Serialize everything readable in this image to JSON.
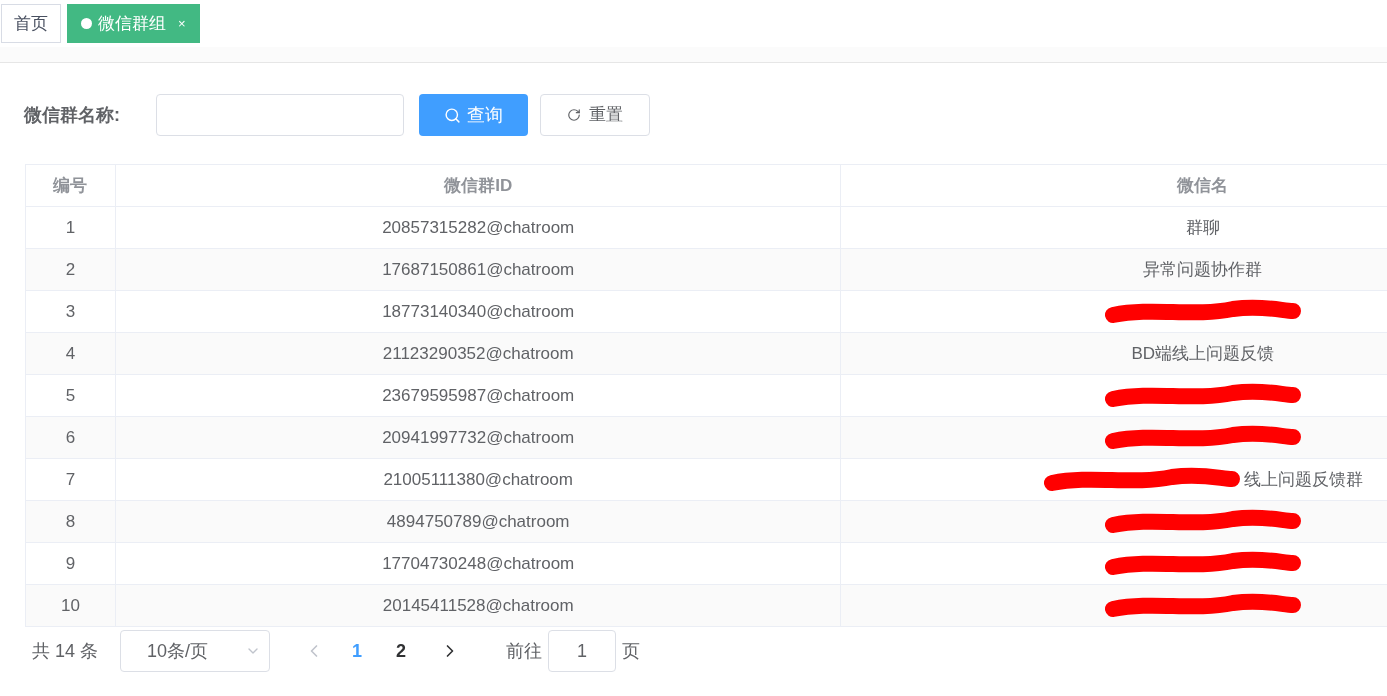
{
  "tabs": [
    {
      "label": "首页",
      "selected": false,
      "closable": false
    },
    {
      "label": "微信群组",
      "selected": true,
      "closable": true,
      "close": "×"
    }
  ],
  "search": {
    "label": "微信群名称:",
    "query_button": "查询",
    "reset_button": "重置"
  },
  "table": {
    "columns": [
      "编号",
      "微信群ID",
      "微信名"
    ],
    "rows": [
      {
        "no": "1",
        "id": "20857315282@chatroom",
        "name": "群聊",
        "redacted": false
      },
      {
        "no": "2",
        "id": "17687150861@chatroom",
        "name": "异常问题协作群",
        "redacted": false
      },
      {
        "no": "3",
        "id": "18773140340@chatroom",
        "redacted": true
      },
      {
        "no": "4",
        "id": "21123290352@chatroom",
        "name": "BD端线上问题反馈",
        "redacted": false
      },
      {
        "no": "5",
        "id": "23679595987@chatroom",
        "redacted": true
      },
      {
        "no": "6",
        "id": "20941997732@chatroom",
        "redacted": true
      },
      {
        "no": "7",
        "id": "21005111380@chatroom",
        "name": "线上问题反馈群",
        "redacted": true
      },
      {
        "no": "8",
        "id": "4894750789@chatroom",
        "redacted": true
      },
      {
        "no": "9",
        "id": "17704730248@chatroom",
        "redacted": true
      },
      {
        "no": "10",
        "id": "20145411528@chatroom",
        "redacted": true
      }
    ]
  },
  "pagination": {
    "total": "共 14 条",
    "page_size": "10条/页",
    "prev_disabled": true,
    "pages": [
      {
        "label": "1",
        "selected": true
      },
      {
        "label": "2",
        "selected": false
      }
    ],
    "goto_label": "前往",
    "goto_value": "1",
    "page_suffix": "页"
  }
}
